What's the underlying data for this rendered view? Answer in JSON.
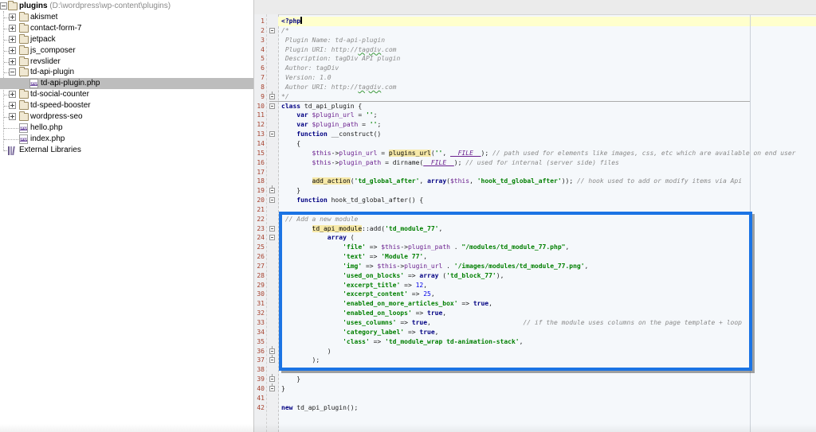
{
  "sidebar": {
    "items": [
      {
        "label": "plugins",
        "path": " (D:\\wordpress\\wp-content\\plugins)",
        "type": "folder",
        "depth": 0,
        "expander": "minus",
        "bold": true,
        "selected": false
      },
      {
        "label": "akismet",
        "type": "folder",
        "depth": 1,
        "expander": "plus",
        "selected": false
      },
      {
        "label": "contact-form-7",
        "type": "folder",
        "depth": 1,
        "expander": "plus",
        "selected": false
      },
      {
        "label": "jetpack",
        "type": "folder",
        "depth": 1,
        "expander": "plus",
        "selected": false
      },
      {
        "label": "js_composer",
        "type": "folder",
        "depth": 1,
        "expander": "plus",
        "selected": false
      },
      {
        "label": "revslider",
        "type": "folder",
        "depth": 1,
        "expander": "plus",
        "selected": false
      },
      {
        "label": "td-api-plugin",
        "type": "folder",
        "depth": 1,
        "expander": "minus",
        "selected": false
      },
      {
        "label": "td-api-plugin.php",
        "type": "php",
        "depth": 2,
        "expander": null,
        "selected": true
      },
      {
        "label": "td-social-counter",
        "type": "folder",
        "depth": 1,
        "expander": "plus",
        "selected": false
      },
      {
        "label": "td-speed-booster",
        "type": "folder",
        "depth": 1,
        "expander": "plus",
        "selected": false
      },
      {
        "label": "wordpress-seo",
        "type": "folder",
        "depth": 1,
        "expander": "plus",
        "selected": false
      },
      {
        "label": "hello.php",
        "type": "php",
        "depth": 1,
        "expander": null,
        "selected": false
      },
      {
        "label": "index.php",
        "type": "php",
        "depth": 1,
        "expander": null,
        "selected": false
      },
      {
        "label": "External Libraries",
        "type": "library",
        "depth": 0,
        "expander": null,
        "selected": false
      }
    ],
    "php_icon_text": "php"
  },
  "editor": {
    "file_language": "php",
    "caret_line": 1,
    "separator_after_line": 9,
    "lines": [
      {
        "n": 1,
        "fold": null,
        "caret": true,
        "tokens": [
          [
            "kw",
            "<?php"
          ]
        ]
      },
      {
        "n": 2,
        "fold": "start",
        "tokens": [
          [
            "com",
            "/*"
          ]
        ]
      },
      {
        "n": 3,
        "fold": null,
        "tokens": [
          [
            "com",
            " Plugin Name: td-api-plugin"
          ]
        ]
      },
      {
        "n": 4,
        "fold": null,
        "tokens": [
          [
            "com",
            " Plugin URI: http://"
          ],
          [
            "comw",
            "tagdiv"
          ],
          [
            "com",
            ".com"
          ]
        ]
      },
      {
        "n": 5,
        "fold": null,
        "tokens": [
          [
            "com",
            " Description: tagDiv API plugin"
          ]
        ]
      },
      {
        "n": 6,
        "fold": null,
        "tokens": [
          [
            "com",
            " Author: tagDiv"
          ]
        ]
      },
      {
        "n": 7,
        "fold": null,
        "tokens": [
          [
            "com",
            " Version: 1.0"
          ]
        ]
      },
      {
        "n": 8,
        "fold": null,
        "tokens": [
          [
            "com",
            " Author URI: http://"
          ],
          [
            "comw",
            "tagdiv"
          ],
          [
            "com",
            ".com"
          ]
        ]
      },
      {
        "n": 9,
        "fold": "end",
        "sep": true,
        "tokens": [
          [
            "com",
            "*/"
          ]
        ]
      },
      {
        "n": 10,
        "fold": "start",
        "tokens": [
          [
            "kw",
            "class"
          ],
          [
            "pl",
            " td_api_plugin {"
          ]
        ]
      },
      {
        "n": 11,
        "fold": null,
        "tokens": [
          [
            "pl",
            "    "
          ],
          [
            "kw",
            "var"
          ],
          [
            "pl",
            " "
          ],
          [
            "var",
            "$plugin_url"
          ],
          [
            "pl",
            " = "
          ],
          [
            "str",
            "''"
          ],
          [
            "pl",
            ";"
          ]
        ]
      },
      {
        "n": 12,
        "fold": null,
        "tokens": [
          [
            "pl",
            "    "
          ],
          [
            "kw",
            "var"
          ],
          [
            "pl",
            " "
          ],
          [
            "var",
            "$plugin_path"
          ],
          [
            "pl",
            " = "
          ],
          [
            "str",
            "''"
          ],
          [
            "pl",
            ";"
          ]
        ]
      },
      {
        "n": 13,
        "fold": "start",
        "tokens": [
          [
            "pl",
            "    "
          ],
          [
            "kw",
            "function"
          ],
          [
            "pl",
            " __construct()"
          ]
        ]
      },
      {
        "n": 14,
        "fold": null,
        "tokens": [
          [
            "pl",
            "    {"
          ]
        ]
      },
      {
        "n": 15,
        "fold": null,
        "tokens": [
          [
            "pl",
            "        "
          ],
          [
            "var",
            "$this"
          ],
          [
            "pl",
            "->"
          ],
          [
            "var",
            "plugin_url"
          ],
          [
            "pl",
            " = "
          ],
          [
            "hlfn",
            "plugins_url"
          ],
          [
            "pl",
            "("
          ],
          [
            "str",
            "''"
          ],
          [
            "pl",
            ", "
          ],
          [
            "file",
            "__FILE__"
          ],
          [
            "pl",
            "); "
          ],
          [
            "com",
            "// path used for elements like images, css, etc which are available on end user"
          ]
        ]
      },
      {
        "n": 16,
        "fold": null,
        "tokens": [
          [
            "pl",
            "        "
          ],
          [
            "var",
            "$this"
          ],
          [
            "pl",
            "->"
          ],
          [
            "var",
            "plugin_path"
          ],
          [
            "pl",
            " = dirname("
          ],
          [
            "file",
            "__FILE__"
          ],
          [
            "pl",
            "); "
          ],
          [
            "com",
            "// used for internal (server side) files"
          ]
        ]
      },
      {
        "n": 17,
        "fold": null,
        "tokens": []
      },
      {
        "n": 18,
        "fold": null,
        "tokens": [
          [
            "pl",
            "        "
          ],
          [
            "hlfn",
            "add_action"
          ],
          [
            "pl",
            "("
          ],
          [
            "str",
            "'td_global_after'"
          ],
          [
            "pl",
            ", "
          ],
          [
            "kw",
            "array"
          ],
          [
            "pl",
            "("
          ],
          [
            "var",
            "$this"
          ],
          [
            "pl",
            ", "
          ],
          [
            "str",
            "'hook_td_global_after'"
          ],
          [
            "pl",
            ")); "
          ],
          [
            "com",
            "// hook used to add or modify items via Api"
          ]
        ]
      },
      {
        "n": 19,
        "fold": "end",
        "tokens": [
          [
            "pl",
            "    }"
          ]
        ]
      },
      {
        "n": 20,
        "fold": "start",
        "tokens": [
          [
            "pl",
            "    "
          ],
          [
            "kw",
            "function"
          ],
          [
            "pl",
            " hook_td_global_after() {"
          ]
        ]
      },
      {
        "n": 21,
        "fold": null,
        "tokens": []
      },
      {
        "n": 22,
        "fold": null,
        "tokens": [
          [
            "pl",
            " "
          ],
          [
            "com",
            "// Add a new module"
          ]
        ]
      },
      {
        "n": 23,
        "fold": "start",
        "tokens": [
          [
            "pl",
            "        "
          ],
          [
            "hlfn",
            "td_api_module"
          ],
          [
            "pl",
            "::add("
          ],
          [
            "str",
            "'td_module_77'"
          ],
          [
            "pl",
            ","
          ]
        ]
      },
      {
        "n": 24,
        "fold": "start",
        "tokens": [
          [
            "pl",
            "            "
          ],
          [
            "kw",
            "array"
          ],
          [
            "pl",
            " ("
          ]
        ]
      },
      {
        "n": 25,
        "fold": null,
        "tokens": [
          [
            "pl",
            "                "
          ],
          [
            "str",
            "'file'"
          ],
          [
            "pl",
            " => "
          ],
          [
            "var",
            "$this"
          ],
          [
            "pl",
            "->"
          ],
          [
            "var",
            "plugin_path"
          ],
          [
            "pl",
            " . "
          ],
          [
            "str",
            "\"/modules/td_module_77.php\""
          ],
          [
            "pl",
            ","
          ]
        ]
      },
      {
        "n": 26,
        "fold": null,
        "tokens": [
          [
            "pl",
            "                "
          ],
          [
            "str",
            "'text'"
          ],
          [
            "pl",
            " => "
          ],
          [
            "str",
            "'Module 77'"
          ],
          [
            "pl",
            ","
          ]
        ]
      },
      {
        "n": 27,
        "fold": null,
        "tokens": [
          [
            "pl",
            "                "
          ],
          [
            "str",
            "'img'"
          ],
          [
            "pl",
            " => "
          ],
          [
            "var",
            "$this"
          ],
          [
            "pl",
            "->"
          ],
          [
            "var",
            "plugin_url"
          ],
          [
            "pl",
            " . "
          ],
          [
            "str",
            "'/images/modules/td_module_77.png'"
          ],
          [
            "pl",
            ","
          ]
        ]
      },
      {
        "n": 28,
        "fold": null,
        "tokens": [
          [
            "pl",
            "                "
          ],
          [
            "str",
            "'used_on_blocks'"
          ],
          [
            "pl",
            " => "
          ],
          [
            "kw",
            "array"
          ],
          [
            "pl",
            " ("
          ],
          [
            "str",
            "'td_block_77'"
          ],
          [
            "pl",
            "),"
          ]
        ]
      },
      {
        "n": 29,
        "fold": null,
        "tokens": [
          [
            "pl",
            "                "
          ],
          [
            "str",
            "'excerpt_title'"
          ],
          [
            "pl",
            " => "
          ],
          [
            "num",
            "12"
          ],
          [
            "pl",
            ","
          ]
        ]
      },
      {
        "n": 30,
        "fold": null,
        "tokens": [
          [
            "pl",
            "                "
          ],
          [
            "str",
            "'excerpt_content'"
          ],
          [
            "pl",
            " => "
          ],
          [
            "num",
            "25"
          ],
          [
            "pl",
            ","
          ]
        ]
      },
      {
        "n": 31,
        "fold": null,
        "tokens": [
          [
            "pl",
            "                "
          ],
          [
            "str",
            "'enabled_on_more_articles_box'"
          ],
          [
            "pl",
            " => "
          ],
          [
            "kw",
            "true"
          ],
          [
            "pl",
            ","
          ]
        ]
      },
      {
        "n": 32,
        "fold": null,
        "tokens": [
          [
            "pl",
            "                "
          ],
          [
            "str",
            "'enabled_on_loops'"
          ],
          [
            "pl",
            " => "
          ],
          [
            "kw",
            "true"
          ],
          [
            "pl",
            ","
          ]
        ]
      },
      {
        "n": 33,
        "fold": null,
        "tokens": [
          [
            "pl",
            "                "
          ],
          [
            "str",
            "'uses_columns'"
          ],
          [
            "pl",
            " => "
          ],
          [
            "kw",
            "true"
          ],
          [
            "pl",
            ",                        "
          ],
          [
            "com",
            "// if the module uses columns on the page template + loop"
          ]
        ]
      },
      {
        "n": 34,
        "fold": null,
        "tokens": [
          [
            "pl",
            "                "
          ],
          [
            "str",
            "'category_label'"
          ],
          [
            "pl",
            " => "
          ],
          [
            "kw",
            "true"
          ],
          [
            "pl",
            ","
          ]
        ]
      },
      {
        "n": 35,
        "fold": null,
        "tokens": [
          [
            "pl",
            "                "
          ],
          [
            "str",
            "'class'"
          ],
          [
            "pl",
            " => "
          ],
          [
            "str",
            "'td_module_wrap td-animation-stack'"
          ],
          [
            "pl",
            ","
          ]
        ]
      },
      {
        "n": 36,
        "fold": "end",
        "tokens": [
          [
            "pl",
            "            )"
          ]
        ]
      },
      {
        "n": 37,
        "fold": "end",
        "tokens": [
          [
            "pl",
            "        );"
          ]
        ]
      },
      {
        "n": 38,
        "fold": null,
        "tokens": []
      },
      {
        "n": 39,
        "fold": "end",
        "tokens": [
          [
            "pl",
            "    }"
          ]
        ]
      },
      {
        "n": 40,
        "fold": "end",
        "tokens": [
          [
            "pl",
            "}"
          ]
        ]
      },
      {
        "n": 41,
        "fold": null,
        "tokens": []
      },
      {
        "n": 42,
        "fold": null,
        "tokens": [
          [
            "kw",
            "new"
          ],
          [
            "pl",
            " td_api_plugin();"
          ]
        ]
      }
    ]
  },
  "colors": {
    "annotation_box": "#1B74E4",
    "selection_gray": "#BDBDBD",
    "caret_line": "#FFFFCC",
    "keyword": "#000082",
    "string": "#007F00",
    "number": "#0000E8",
    "comment": "#8A8A8A",
    "variable": "#6A1F8E",
    "line_number": "#A6402C",
    "usage_highlight": "#F7E9A8",
    "editor_bg": "#F5F8FB"
  }
}
